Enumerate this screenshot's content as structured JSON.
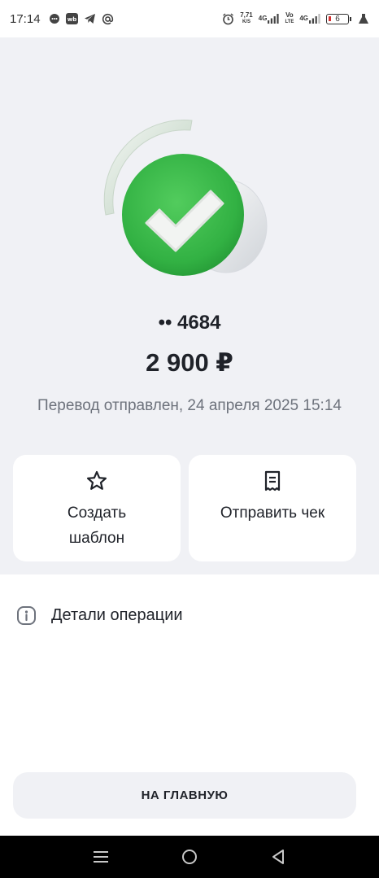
{
  "status_bar": {
    "time": "17:14",
    "net_speed_value": "7,71",
    "net_speed_unit": "K/S",
    "signal1_label": "4G",
    "volte_top": "Vo",
    "volte_bottom": "LTE",
    "signal2_label": "4G",
    "battery_level": "6",
    "left_icons": [
      "message-icon",
      "wb-icon",
      "telegram-icon",
      "at-icon"
    ],
    "right_icons": [
      "alarm-icon",
      "signal-icon",
      "battery-icon",
      "android-icon"
    ]
  },
  "transfer": {
    "card_number": "•• 4684",
    "amount": "2 900 ₽",
    "status": "Перевод отправлен, 24 апреля 2025 15:14",
    "success_icon": "checkmark-icon"
  },
  "actions": [
    {
      "label": "Создать шаблон",
      "icon": "star-icon"
    },
    {
      "label": "Отправить чек",
      "icon": "receipt-icon"
    }
  ],
  "details": {
    "label": "Детали операции",
    "icon": "info-icon"
  },
  "home_button": {
    "label": "НА ГЛАВНУЮ"
  },
  "nav_bar": {
    "icons": [
      "menu-icon",
      "home-icon",
      "back-icon"
    ]
  },
  "colors": {
    "background": "#f0f1f5",
    "success_green": "#3dbb4d",
    "text_primary": "#1f2229",
    "text_secondary": "#6d727c"
  }
}
